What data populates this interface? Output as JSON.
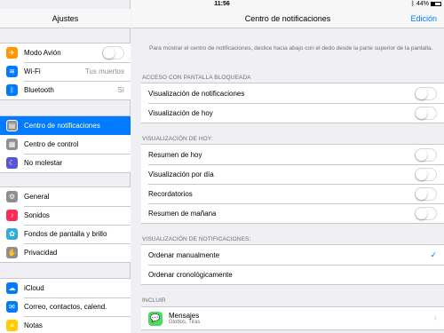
{
  "status": {
    "device": "iPad",
    "time": "11:56",
    "battery": "44%",
    "battery_level": 0.44
  },
  "sidebar": {
    "title": "Ajustes",
    "groups": [
      [
        {
          "label": "Modo Avión",
          "icon": "airplane-icon",
          "color": "#ff9500",
          "glyph": "✈",
          "toggle": true
        },
        {
          "label": "Wi-Fi",
          "icon": "wifi-icon",
          "color": "#007aff",
          "glyph": "≋",
          "value": "Tus muertos"
        },
        {
          "label": "Bluetooth",
          "icon": "bluetooth-icon",
          "color": "#007aff",
          "glyph": "ᛒ",
          "value": "Sí"
        }
      ],
      [
        {
          "label": "Centro de notificaciones",
          "icon": "notification-center-icon",
          "color": "#8e8e93",
          "glyph": "▤",
          "selected": true
        },
        {
          "label": "Centro de control",
          "icon": "control-center-icon",
          "color": "#8e8e93",
          "glyph": "▦"
        },
        {
          "label": "No molestar",
          "icon": "do-not-disturb-icon",
          "color": "#5856d6",
          "glyph": "☾"
        }
      ],
      [
        {
          "label": "General",
          "icon": "gear-icon",
          "color": "#8e8e93",
          "glyph": "⚙"
        },
        {
          "label": "Sonidos",
          "icon": "sound-icon",
          "color": "#ff2d55",
          "glyph": "♪"
        },
        {
          "label": "Fondos de pantalla y brillo",
          "icon": "wallpaper-icon",
          "color": "#34aadc",
          "glyph": "✿"
        },
        {
          "label": "Privacidad",
          "icon": "privacy-hand-icon",
          "color": "#8e8e93",
          "glyph": "✋"
        }
      ],
      [
        {
          "label": "iCloud",
          "icon": "icloud-icon",
          "color": "#007aff",
          "glyph": "☁"
        },
        {
          "label": "Correo, contactos, calend.",
          "icon": "mail-icon",
          "color": "#007aff",
          "glyph": "✉"
        },
        {
          "label": "Notas",
          "icon": "notes-icon",
          "color": "#ffcc00",
          "glyph": "≡"
        }
      ]
    ]
  },
  "main": {
    "title": "Centro de notificaciones",
    "edit": "Edición",
    "info": "Para mostrar el centro de notificaciones, deslice hacia abajo con el dedo desde la parte superior de la pantalla.",
    "lock_screen": {
      "label": "ACCESO CON PANTALLA BLOQUEADA",
      "items": [
        "Visualización de notificaciones",
        "Visualización de hoy"
      ]
    },
    "today_view": {
      "label": "VISUALIZACIÓN DE HOY:",
      "items": [
        "Resumen de hoy",
        "Visualización por día",
        "Recordatorios",
        "Resumen de mañana"
      ]
    },
    "notif_view": {
      "label": "VISUALIZACIÓN DE NOTIFICACIONES:",
      "items": [
        "Ordenar manualmente",
        "Ordenar cronológicamente"
      ],
      "selected_index": 0
    },
    "include": {
      "label": "INCLUIR",
      "apps": [
        {
          "name": "Mensajes",
          "subtitle": "Globos, Tiras",
          "icon": "messages-icon"
        }
      ]
    }
  }
}
